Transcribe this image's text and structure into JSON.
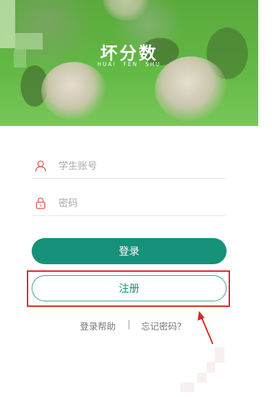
{
  "app": {
    "logo_title": "坏分数",
    "logo_subtitle": "HUAI  FEN  SHU"
  },
  "login_form": {
    "username_placeholder": "学生账号",
    "username_icon": "user-icon",
    "password_placeholder": "密码",
    "password_icon": "lock-icon",
    "login_label": "登录",
    "register_label": "注册"
  },
  "links": {
    "help_label": "登录帮助",
    "separator": "|",
    "forgot_label": "忘记密码？"
  },
  "colors": {
    "primary": "#16917a",
    "icon_red": "#e0705f",
    "annotation_red": "#d4281f"
  }
}
